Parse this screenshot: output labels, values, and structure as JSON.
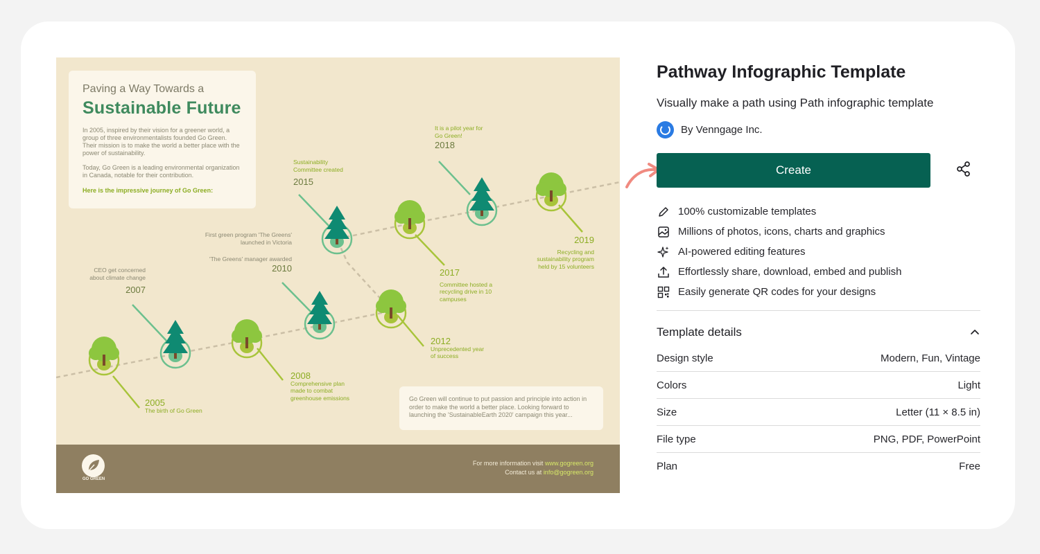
{
  "infographic": {
    "intro_subtitle": "Paving a Way Towards a",
    "intro_title": "Sustainable Future",
    "intro_p1": "In 2005, inspired by their vision for a greener world, a group of three environmentalists founded Go Green. Their mission is to make the world a better place with the power of sustainability.",
    "intro_p2": "Today, Go Green is a leading environmental organization in Canada, notable for their contribution.",
    "intro_cta": "Here is the impressive journey of Go Green:",
    "events": [
      {
        "year": "2005",
        "text": "The birth of Go Green"
      },
      {
        "year": "2007",
        "text": "CEO get concerned about climate change"
      },
      {
        "year": "2008",
        "text": "Comprehensive plan made to combat greenhouse emissions"
      },
      {
        "year": "2010",
        "text": "First green program 'The Greens' launched in Victoria"
      },
      {
        "year": "",
        "text": "'The Greens' manager awarded"
      },
      {
        "year": "2012",
        "text": "Unprecedented year of success"
      },
      {
        "year": "2015",
        "text": "Sustainability Committee created"
      },
      {
        "year": "2017",
        "text": "Committee hosted a recycling drive in 10 campuses"
      },
      {
        "year": "2018",
        "text": "It is a pilot year for Go Green!"
      },
      {
        "year": "2019",
        "text": "Recycling and sustainability program held by 15 volunteers"
      }
    ],
    "closing": "Go Green will continue to put passion and principle into action in order to make the world a better place. Looking forward to launching the 'SustainableEarth 2020' campaign this year...",
    "logo_text": "GO GREEN",
    "footer_visit": "For more information visit",
    "footer_url": "www.gogreen.org",
    "footer_contact": "Contact us at",
    "footer_email": "info@gogreen.org"
  },
  "panel": {
    "title": "Pathway Infographic Template",
    "subtitle": "Visually make a path using Path infographic template",
    "author": "By Venngage Inc.",
    "create_label": "Create",
    "features": [
      {
        "icon": "pencil-icon",
        "label": "100% customizable templates"
      },
      {
        "icon": "image-icon",
        "label": "Millions of photos, icons, charts and graphics"
      },
      {
        "icon": "sparkles-icon",
        "label": "AI-powered editing features"
      },
      {
        "icon": "upload-icon",
        "label": "Effortlessly share, download, embed and publish"
      },
      {
        "icon": "qr-code-icon",
        "label": "Easily generate QR codes for your designs"
      }
    ],
    "details_title": "Template details",
    "details": [
      {
        "label": "Design style",
        "value": "Modern, Fun, Vintage"
      },
      {
        "label": "Colors",
        "value": "Light"
      },
      {
        "label": "Size",
        "value": "Letter (11 × 8.5 in)"
      },
      {
        "label": "File type",
        "value": "PNG, PDF, PowerPoint"
      },
      {
        "label": "Plan",
        "value": "Free"
      }
    ]
  },
  "colors": {
    "create_button": "#066152",
    "infographic_bg": "#f2e7cd",
    "footer_bg": "#8f7f61",
    "accent_green": "#3f8a5e",
    "lime": "#8cad23",
    "arrow": "#f08a80"
  }
}
